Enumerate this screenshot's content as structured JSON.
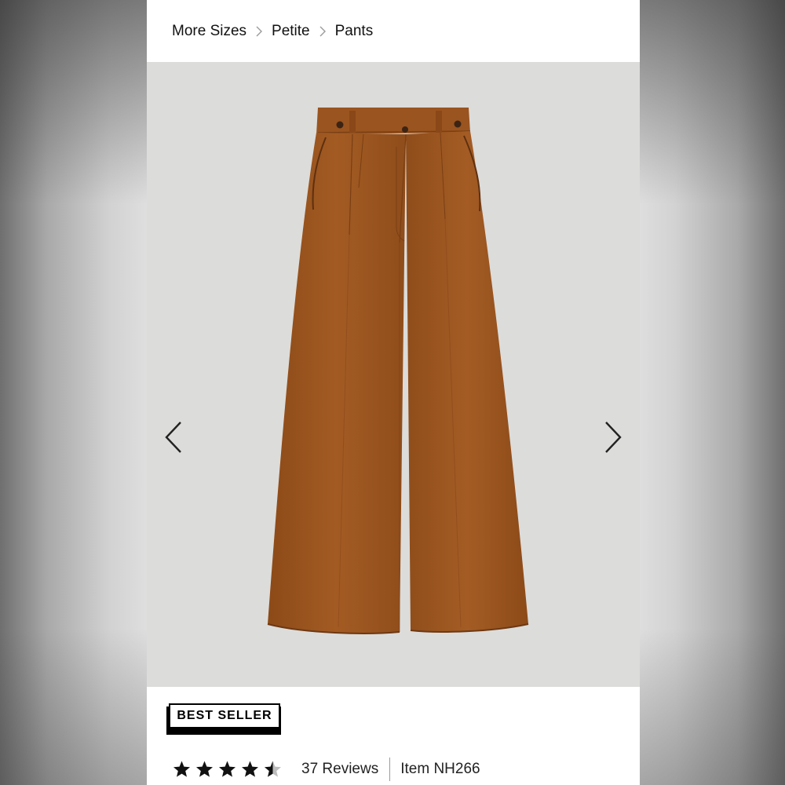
{
  "breadcrumb": {
    "items": [
      "More Sizes",
      "Petite",
      "Pants"
    ]
  },
  "product": {
    "badge": "BEST SELLER",
    "rating": 4.5,
    "rating_max": 5,
    "reviews_text": "37 Reviews",
    "item_text": "Item NH266",
    "image_bg_color": "#dcdcda",
    "garment_color": "#9a541f"
  },
  "icons": {
    "breadcrumb_separator": "chevron-right-icon",
    "prev": "chevron-left-icon",
    "next": "chevron-right-icon",
    "star": "star-icon"
  }
}
